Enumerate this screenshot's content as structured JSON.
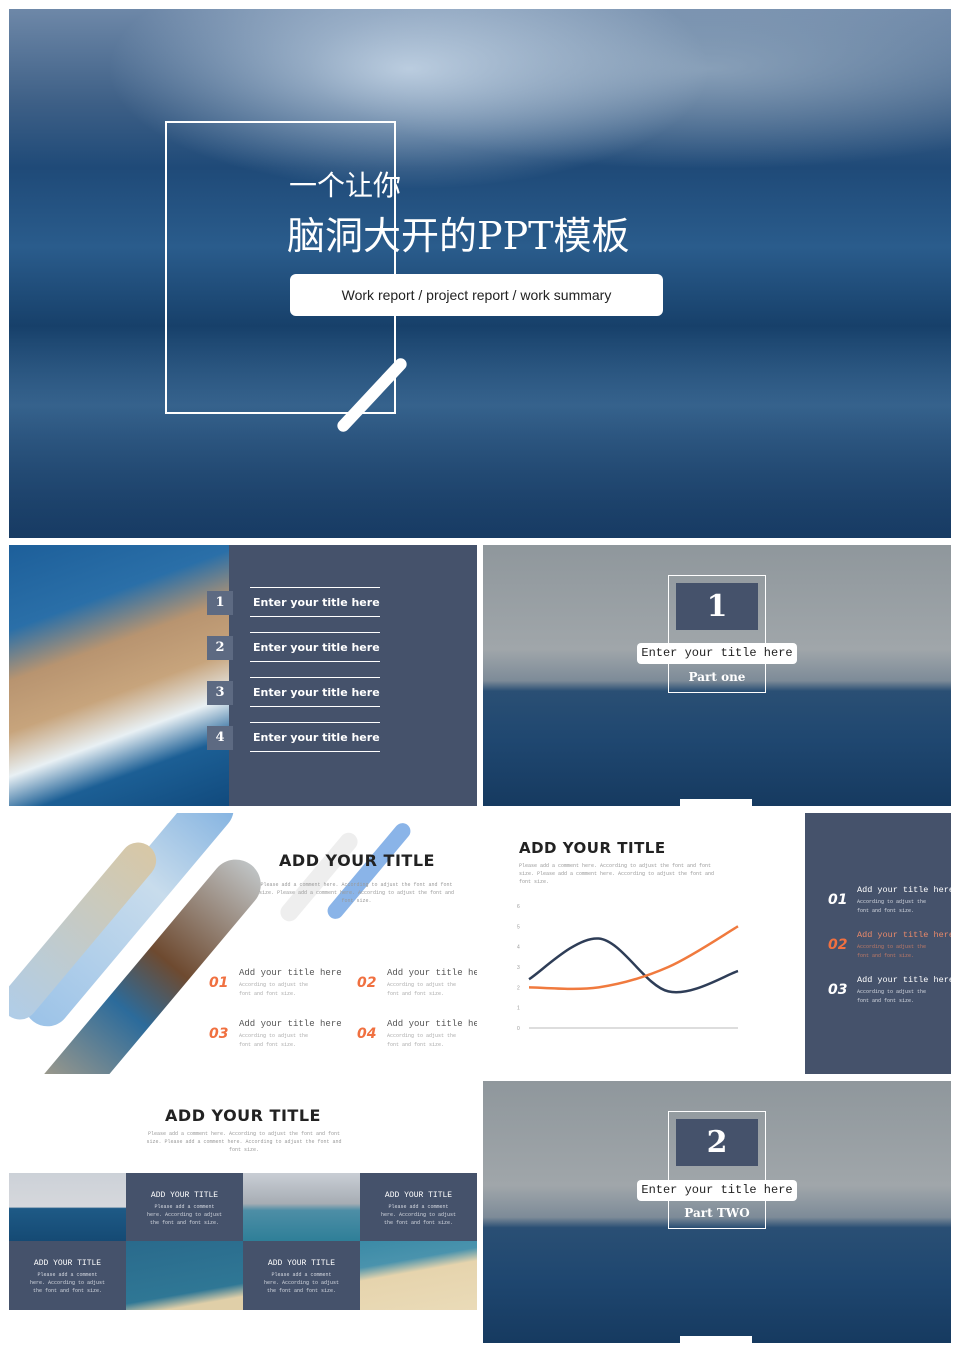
{
  "cover": {
    "line1": "一个让你",
    "line2": "脑洞大开的PPT模板",
    "subtitle": "Work report / project report / work summary"
  },
  "contents": {
    "items": [
      {
        "num": "1",
        "label": "Enter your title here"
      },
      {
        "num": "2",
        "label": "Enter your title here"
      },
      {
        "num": "3",
        "label": "Enter your title here"
      },
      {
        "num": "4",
        "label": "Enter your title here"
      }
    ]
  },
  "part1": {
    "num": "1",
    "title": "Enter your title here",
    "part": "Part one"
  },
  "part2": {
    "num": "2",
    "title": "Enter your title here",
    "part": "Part TWO"
  },
  "features": {
    "title": "ADD YOUR TITLE",
    "comment": "Please add a comment here. According to adjust the font and font size. Please add a comment here. According to adjust the font and font size.",
    "items": [
      {
        "num": "01",
        "title": "Add your title here",
        "desc": "According to adjust the font and font size."
      },
      {
        "num": "02",
        "title": "Add your title here",
        "desc": "According to adjust the font and font size."
      },
      {
        "num": "03",
        "title": "Add your title here",
        "desc": "According to adjust the font and font size."
      },
      {
        "num": "04",
        "title": "Add your title here",
        "desc": "According to adjust the font and font size."
      }
    ]
  },
  "chart_slide": {
    "title": "ADD YOUR TITLE",
    "comment": "Please add a comment here. According to adjust the font and font size. Please add a comment here. According to adjust the font and font size.",
    "items": [
      {
        "num": "01",
        "title": "Add your title here",
        "desc": "According to adjust the font and font size.",
        "highlight": false
      },
      {
        "num": "02",
        "title": "Add your title here",
        "desc": "According to adjust the font and font size.",
        "highlight": true
      },
      {
        "num": "03",
        "title": "Add your title here",
        "desc": "According to adjust the font and font size.",
        "highlight": false
      }
    ]
  },
  "chart_data": {
    "type": "line",
    "smooth": true,
    "ylim": [
      0,
      6
    ],
    "yticks": [
      "0",
      "1",
      "2",
      "3",
      "4",
      "5",
      "6"
    ],
    "x": [
      1,
      2,
      3,
      4
    ],
    "grid": false,
    "series": [
      {
        "values": [
          2.4,
          4.4,
          1.8,
          2.8
        ],
        "color": "#2e3d57"
      },
      {
        "values": [
          2.0,
          2.0,
          3.0,
          5.0
        ],
        "color": "#f07a3e"
      }
    ]
  },
  "grid_slide": {
    "title": "ADD YOUR TITLE",
    "comment": "Please add a comment here. According to adjust the font and font size. Please add a comment here. According to adjust the font and font size.",
    "cards": [
      {
        "title": "ADD YOUR TITLE",
        "desc": "Please add a comment here. According to adjust the font and font size."
      },
      {
        "title": "ADD YOUR TITLE",
        "desc": "Please add a comment here. According to adjust the font and font size."
      },
      {
        "title": "ADD YOUR TITLE",
        "desc": "Please add a comment here. According to adjust the font and font size."
      },
      {
        "title": "ADD YOUR TITLE",
        "desc": "Please add a comment here. According to adjust the font and font size."
      }
    ]
  },
  "colors": {
    "navy": "#45526b",
    "accent": "#f07040"
  }
}
